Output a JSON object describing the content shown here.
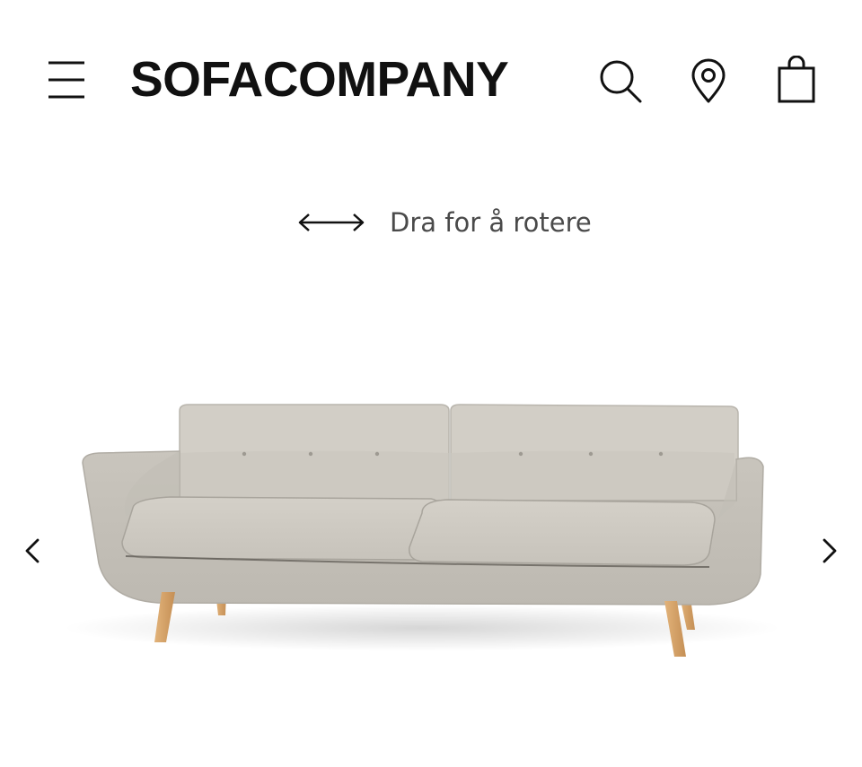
{
  "header": {
    "logo_text": "SOFACOMPANY",
    "icons": [
      "menu-icon",
      "search-icon",
      "location-pin-icon",
      "shopping-bag-icon"
    ]
  },
  "viewer": {
    "rotate_hint": "Dra for å rotere",
    "rotate_icon": "double-arrow-icon",
    "product_image": "grey-three-seat-sofa",
    "prev_icon": "chevron-left-icon",
    "next_icon": "chevron-right-icon"
  },
  "colors": {
    "text": "#111111",
    "hint_text": "#4a4a4a",
    "fabric": "#cfcbc3",
    "legs": "#d6a76c"
  }
}
